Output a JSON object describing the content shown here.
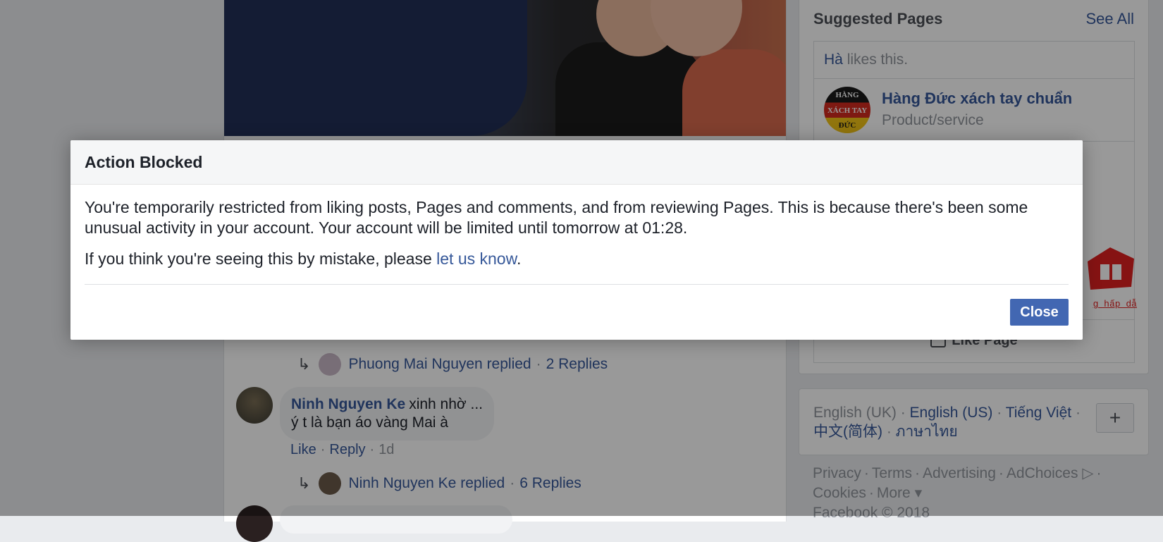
{
  "feed": {
    "reply_1": {
      "author_text": "Phuong Mai Nguyen replied",
      "count": "2 Replies"
    },
    "comment": {
      "author": "Ninh Nguyen Ke",
      "text_line1": "xinh nhờ ...",
      "text_line2": "ý t là bạn áo vàng Mai à",
      "like": "Like",
      "reply": "Reply",
      "time": "1d"
    },
    "reply_2": {
      "author_text": "Ninh Nguyen Ke replied",
      "count": "6 Replies"
    }
  },
  "sidebar": {
    "title": "Suggested Pages",
    "see_all": "See All",
    "liker": "Hà",
    "likes_text": "likes this.",
    "page": {
      "logo_line1": "HÀNG",
      "logo_line2": "XÁCH TAY",
      "logo_line3": "ĐỨC",
      "name": "Hàng Đức xách tay chuẩn",
      "category": "Product/service"
    },
    "promo_text": "g hấp dẫ",
    "like_page": "Like Page"
  },
  "languages": {
    "current": "English (UK)",
    "items": [
      "English (US)",
      "Tiếng Việt",
      "中文(简体)",
      "ภาษาไทย"
    ],
    "more_button": "+"
  },
  "footer": {
    "links": [
      "Privacy",
      "Terms",
      "Advertising",
      "AdChoices",
      "Cookies",
      "More"
    ],
    "copyright": "Facebook © 2018"
  },
  "dialog": {
    "title": "Action Blocked",
    "message": "You're temporarily restricted from liking posts, Pages and comments, and from reviewing Pages. This is because there's been some unusual activity in your account. Your account will be limited until tomorrow at 01:28.",
    "mistake_prefix": "If you think you're seeing this by mistake, please",
    "mistake_link": "let us know",
    "mistake_suffix": ".",
    "close_label": "Close"
  },
  "colors": {
    "link": "#365899",
    "button": "#4267b2",
    "page_bg": "#e9ebee"
  }
}
